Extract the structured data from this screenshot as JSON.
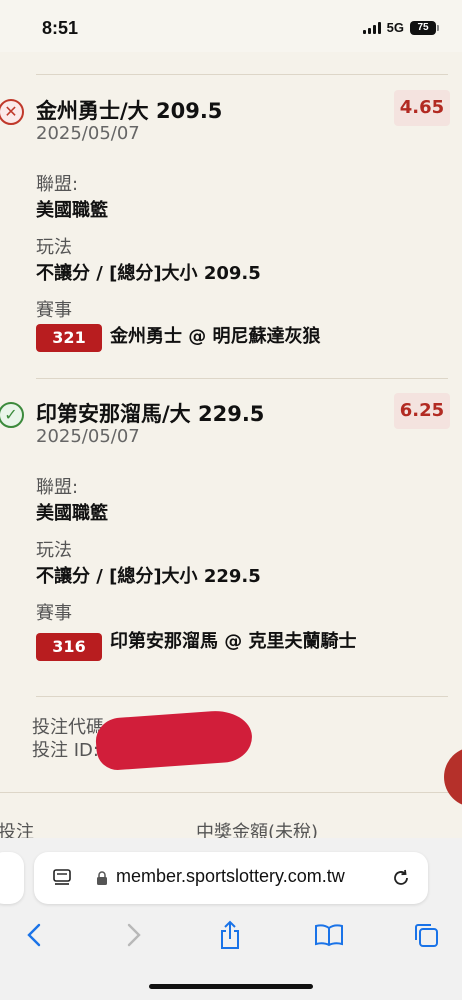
{
  "status_bar": {
    "time": "8:51",
    "network": "5G",
    "battery": "75"
  },
  "bets": [
    {
      "result": "lost",
      "status_symbol": "✕",
      "title": "金州勇士/大 209.5",
      "date": "2025/05/07",
      "odds": "4.65",
      "league_label": "聯盟:",
      "league": "美國職籃",
      "play_label": "玩法",
      "play": "不讓分 / [總分]大小 209.5",
      "event_label": "賽事",
      "event_code": "321",
      "event": "金州勇士 @ 明尼蘇達灰狼"
    },
    {
      "result": "won",
      "status_symbol": "✓",
      "title": "印第安那溜馬/大 229.5",
      "date": "2025/05/07",
      "odds": "6.25",
      "league_label": "聯盟:",
      "league": "美國職籃",
      "play_label": "玩法",
      "play": "不讓分 / [總分]大小 229.5",
      "event_label": "賽事",
      "event_code": "316",
      "event": "印第安那溜馬 @ 克里夫蘭騎士"
    }
  ],
  "bet_code_label": "投注代碼::",
  "bet_id_label": "投注 ID:",
  "footer": {
    "left_label": "投注",
    "right_label": "中獎金額(未稅)"
  },
  "browser": {
    "url": "member.sportslottery.com.tw"
  },
  "colors": {
    "accent_red": "#b81d1f",
    "odds_text": "#b22a22",
    "odds_bg": "#f4e3df",
    "won_green": "#3c8a3c"
  },
  "icons": [
    "reader-mode-icon",
    "lock-icon",
    "reload-icon",
    "back-icon",
    "forward-icon",
    "share-icon",
    "bookmarks-icon",
    "tabs-icon"
  ]
}
